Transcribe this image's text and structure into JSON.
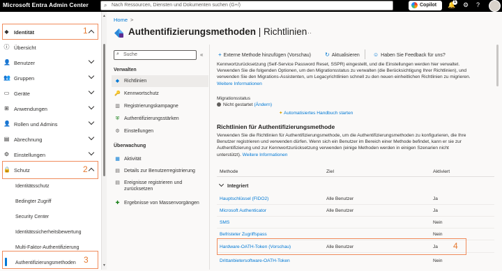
{
  "topbar": {
    "brand": "Microsoft Entra Admin Center",
    "search_placeholder": "Nach Ressourcen, Diensten und Dokumenten suchen (G+/)",
    "copilot_label": "Copilot",
    "notification_count": "1",
    "icons": [
      "search-icon",
      "copilot-icon",
      "bell-icon",
      "settings-icon",
      "help-icon",
      "avatar"
    ]
  },
  "leftnav": {
    "items": [
      {
        "label": "Identität",
        "icon": "diamond-icon",
        "expanded": true,
        "annotation": "1"
      },
      {
        "label": "Übersicht",
        "icon": "info-icon"
      },
      {
        "label": "Benutzer",
        "icon": "user-icon"
      },
      {
        "label": "Gruppen",
        "icon": "group-icon"
      },
      {
        "label": "Geräte",
        "icon": "device-icon"
      },
      {
        "label": "Anwendungen",
        "icon": "apps-icon"
      },
      {
        "label": "Rollen und Admins",
        "icon": "roles-icon"
      },
      {
        "label": "Abrechnung",
        "icon": "billing-icon"
      },
      {
        "label": "Einstellungen",
        "icon": "gear-icon"
      },
      {
        "label": "Schutz",
        "icon": "lock-icon",
        "expanded": true,
        "annotation": "2"
      }
    ],
    "schutz_children": [
      "Identitätsschutz",
      "Bedingter Zugriff",
      "Security Center",
      "Identitätssicherheitsbewertung",
      "Multi-Faktor-Authentifizierung",
      "Authentifizierungsmethoden"
    ],
    "selected_annotation": "3"
  },
  "breadcrumb": {
    "home": "Home",
    "sep": ">"
  },
  "page": {
    "title_main": "Authentifizierungsmethoden",
    "title_sep": " | ",
    "title_sub": "Richtlinien",
    "more": "···"
  },
  "subnav": {
    "search_placeholder": "Suche",
    "collapse": "«",
    "section_manage": "Verwalten",
    "manage_items": [
      {
        "label": "Richtlinien",
        "icon": "policy-icon",
        "selected": true
      },
      {
        "label": "Kennwortschutz",
        "icon": "key-icon"
      },
      {
        "label": "Registrierungskampagne",
        "icon": "campaign-icon"
      },
      {
        "label": "Authentifizierungsstärken",
        "icon": "shield-icon"
      },
      {
        "label": "Einstellungen",
        "icon": "gear-icon"
      }
    ],
    "section_monitor": "Überwachung",
    "monitor_items": [
      {
        "label": "Aktivität",
        "icon": "activity-icon"
      },
      {
        "label": "Details zur Benutzerregistrierung",
        "icon": "details-icon"
      },
      {
        "label": "Ereignisse registrieren und",
        "label2": "zurücksetzen",
        "icon": "events-icon"
      },
      {
        "label": "Ergebnisse von Massenvorgängen",
        "icon": "bulk-icon"
      }
    ]
  },
  "commands": {
    "add_external": "Externe Methode hinzufügen (Vorschau)",
    "refresh": "Aktualisieren",
    "feedback": "Haben Sie Feedback für uns?"
  },
  "intro": {
    "line1": "Kennwortzurücksetzung (Self-Service Password Reset, SSPR) eingestellt, und die Einstellungen werden hier verwaltet.",
    "line2": "Verwenden Sie die folgenden Optionen, um den Migrationsstatus zu verwalten (die Berücksichtigung Ihrer Richtlinien), und",
    "line3": "verwenden Sie den Migrations-Assistenten, um Legacyrichtlinien schnell zu den neuen einheitlichen Richtlinien zu migrieren.",
    "link": "Weitere Informationen"
  },
  "migration": {
    "label": "Migrationsstatus",
    "status": "Nicht gestartet",
    "change_link": "(Ändern)",
    "playbook": "Automatisiertes Handbuch starten"
  },
  "policies": {
    "heading": "Richtlinien für Authentifizierungsmethode",
    "desc1": "Verwenden Sie die Richtlinien für Authentifizierungsmethode, um die Authentifizierungsmethoden zu konfigurieren, die Ihre",
    "desc2": "Benutzer registrieren und verwenden dürfen. Wenn sich ein Benutzer im Bereich einer Methode befindet, kann er sie zur",
    "desc3": "Authentifizierung und zur Kennwortzurücksetzung verwenden (einige Methoden werden in einigen Szenarien nicht",
    "desc4": "unterstützt).",
    "link": "Weitere Informationen"
  },
  "table": {
    "headers": {
      "method": "Methode",
      "target": "Ziel",
      "enabled": "Aktiviert"
    },
    "group": "Integriert",
    "rows": [
      {
        "method": "Hauptschlüssel (FIDO2)",
        "target": "Alle Benutzer",
        "enabled": "Ja"
      },
      {
        "method": "Microsoft Authenticator",
        "target": "Alle Benutzer",
        "enabled": "Ja"
      },
      {
        "method": "SMS",
        "target": "",
        "enabled": "Nein"
      },
      {
        "method": "Befristeter Zugriffspass",
        "target": "",
        "enabled": "Nein"
      },
      {
        "method": "Hardware-OATH-Token (Vorschau)",
        "target": "Alle Benutzer",
        "enabled": "Ja"
      },
      {
        "method": "Drittanbietersoftware-OATH-Token",
        "target": "",
        "enabled": "Nein"
      }
    ],
    "highlight_annotation": "4"
  },
  "colors": {
    "accent": "#0078d4",
    "annotation": "#f08b5b",
    "topbar": "#000000"
  }
}
